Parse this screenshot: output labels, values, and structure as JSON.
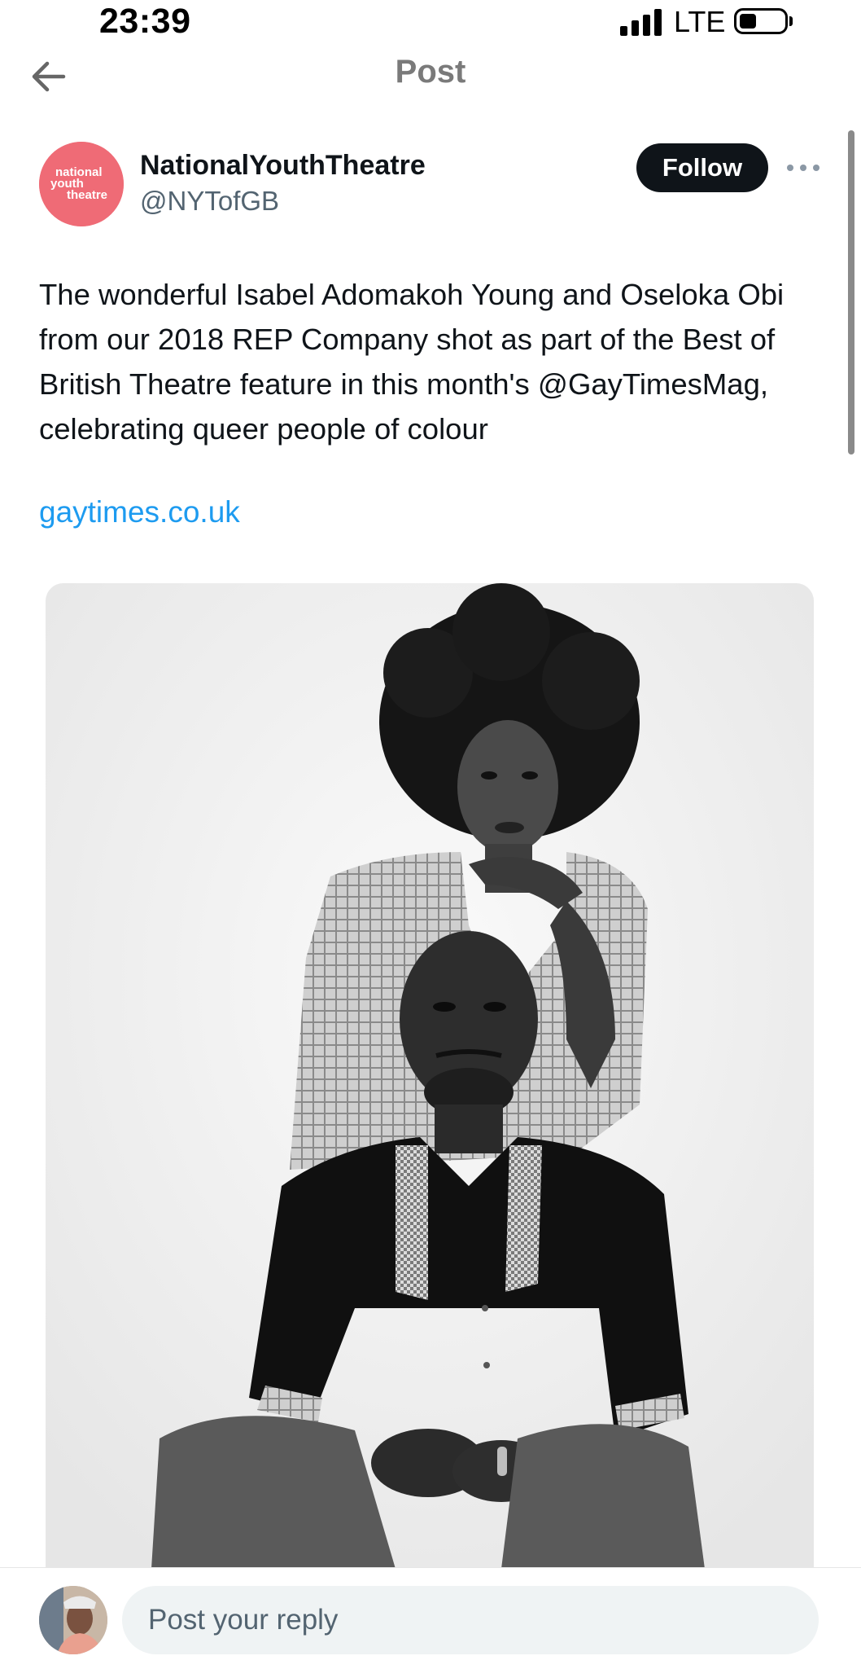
{
  "status_bar": {
    "time": "23:39",
    "network": "LTE",
    "icons": [
      "signal-bars-icon",
      "battery-icon"
    ]
  },
  "header": {
    "title": "Post",
    "back_icon": "arrow-left-icon"
  },
  "post": {
    "author": {
      "display_name": "NationalYouthTheatre",
      "handle": "@NYTofGB",
      "avatar_logo_text": "national youth theatre",
      "avatar_color": "#ef6b76"
    },
    "follow_label": "Follow",
    "more_icon": "ellipsis-icon",
    "text": "The wonderful Isabel Adomakoh Young and Oseloka Obi from our 2018 REP Company shot as part of the Best of British Theatre feature in this month's @GayTimesMag, celebrating queer people of colour",
    "link": "gaytimes.co.uk",
    "link_color": "#1d9bf0",
    "media": "black-and-white portrait photo"
  },
  "reply_bar": {
    "placeholder": "Post your reply"
  }
}
